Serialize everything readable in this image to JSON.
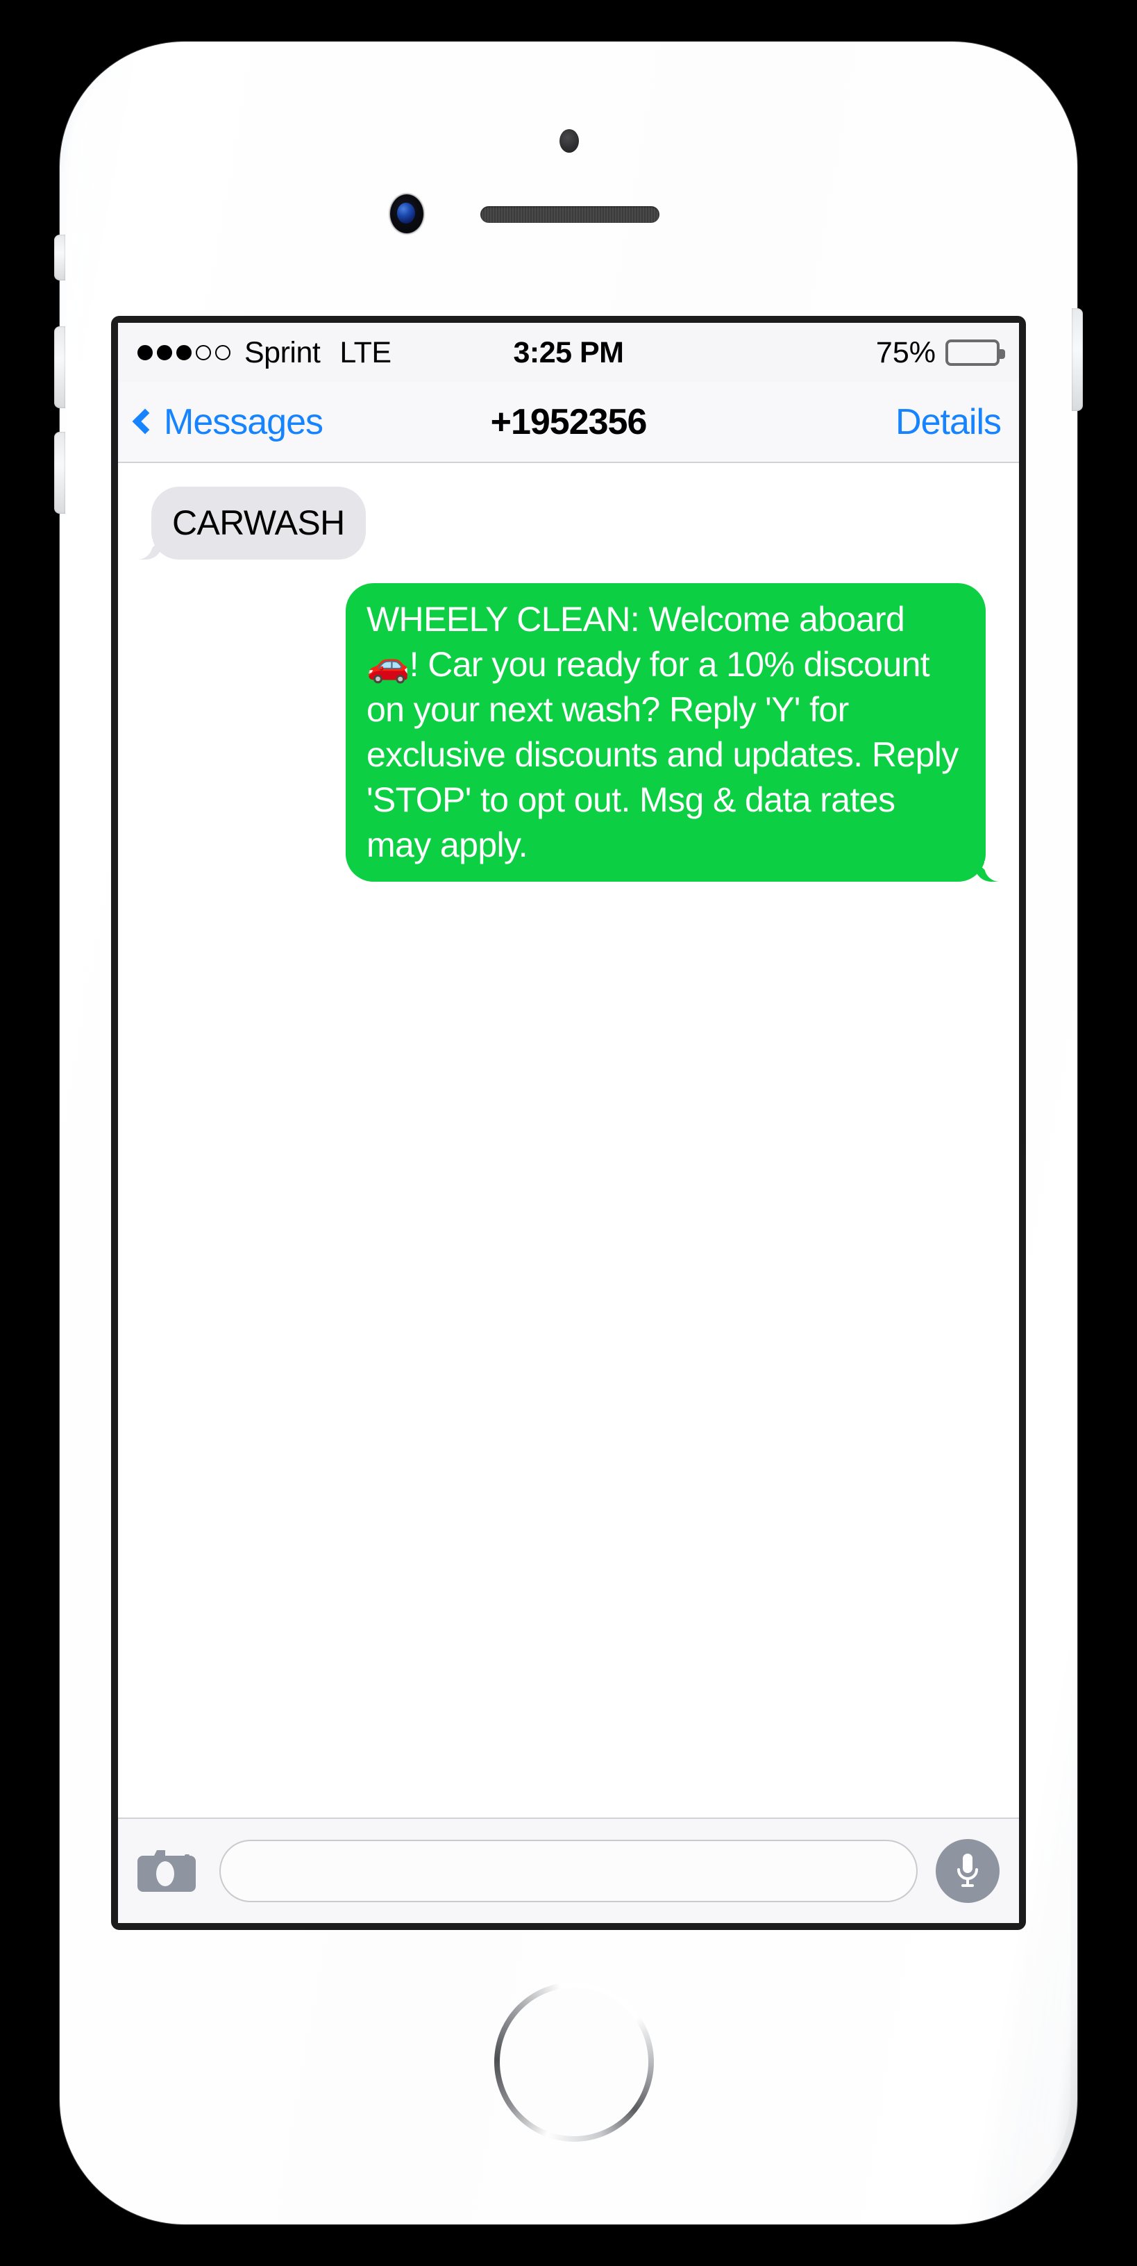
{
  "device": {
    "name": "iPhone",
    "color": "silver-white",
    "sensors": {
      "proximity": "proximity-sensor",
      "camera": "front-camera",
      "speaker": "earpiece-speaker-grille",
      "home": "home-button"
    },
    "buttons": {
      "mute": "mute-switch",
      "volume_up": "volume-up-button",
      "volume_down": "volume-down-button",
      "power": "power-button"
    }
  },
  "status_bar": {
    "signal_total": 5,
    "signal_filled": 3,
    "carrier": "Sprint",
    "network_type": "LTE",
    "time": "3:25 PM",
    "battery_percent_label": "75%",
    "battery_percent": 75
  },
  "nav_bar": {
    "back_label": "Messages",
    "back_icon": "chevron-left-icon",
    "title": "+1952356",
    "details_label": "Details"
  },
  "conversation": {
    "messages": [
      {
        "direction": "incoming",
        "text": "CARWASH"
      },
      {
        "direction": "outgoing",
        "text": "WHEELY CLEAN: Welcome aboard 🚗! Car you ready for a 10% discount on your next wash? Reply 'Y' for exclusive discounts and updates. Reply 'STOP' to opt out. Msg & data rates may apply."
      }
    ]
  },
  "input_bar": {
    "camera_icon": "camera-icon",
    "input_value": "",
    "input_placeholder": "",
    "mic_icon": "microphone-icon"
  },
  "colors": {
    "outgoing_bubble": "#0ccf43",
    "incoming_bubble": "#e5e5ea",
    "accent_blue": "#1784ff",
    "status_bar_bg": "#f6f6f8",
    "toolbar_bg": "#f7f7f9",
    "mic_button_bg": "#8e94a0",
    "camera_icon_fill": "#8e94a0"
  }
}
